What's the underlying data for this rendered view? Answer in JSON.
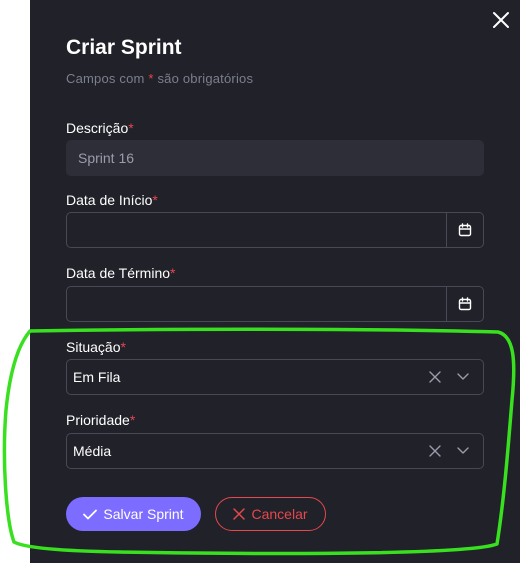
{
  "form": {
    "title": "Criar Sprint",
    "subtitle_prefix": "Campos com",
    "subtitle_star": "*",
    "subtitle_suffix": "são obrigatórios",
    "required_mark": "*",
    "fields": {
      "description": {
        "label": "Descrição",
        "value": "Sprint 16"
      },
      "start_date": {
        "label": "Data de Início",
        "value": ""
      },
      "end_date": {
        "label": "Data de Término",
        "value": ""
      },
      "status": {
        "label": "Situação",
        "value": "Em Fila"
      },
      "priority": {
        "label": "Prioridade",
        "value": "Média"
      }
    },
    "actions": {
      "save_label": "Salvar Sprint",
      "cancel_label": "Cancelar"
    }
  },
  "icons": {
    "close": "close-icon",
    "calendar": "calendar-icon",
    "clear": "clear-icon",
    "chevron": "chevron-down-icon",
    "check": "check-icon",
    "x": "x-icon"
  },
  "colors": {
    "panel_bg": "#202129",
    "accent": "#7c6cff",
    "danger": "#e5484d",
    "highlight": "#39e01f"
  }
}
